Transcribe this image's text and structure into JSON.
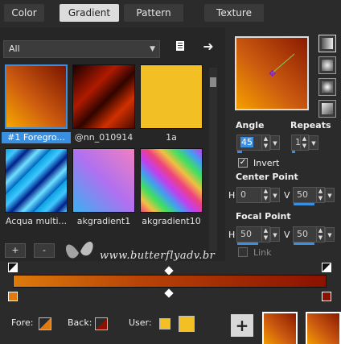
{
  "tabs": [
    {
      "label": "Color",
      "active": false
    },
    {
      "label": "Gradient",
      "active": true
    },
    {
      "label": "Pattern",
      "active": false
    },
    {
      "label": "Texture",
      "active": false
    }
  ],
  "library": {
    "filter_value": "All",
    "items": [
      {
        "label": "#1 Foregro...",
        "selected": true
      },
      {
        "label": "@nn_010914",
        "selected": false
      },
      {
        "label": "1a",
        "selected": false
      },
      {
        "label": "Acqua multi...",
        "selected": false
      },
      {
        "label": "akgradient1",
        "selected": false
      },
      {
        "label": "akgradient10",
        "selected": false
      }
    ],
    "add_label": "+",
    "remove_label": "-"
  },
  "watermark": "www.butterflyadv.br",
  "properties": {
    "angle_label": "Angle",
    "angle_value": "45",
    "repeats_label": "Repeats",
    "repeats_value": "1",
    "invert_label": "Invert",
    "invert_checked": true,
    "center_label": "Center Point",
    "center_h_label": "H",
    "center_h_value": "0",
    "center_v_label": "V",
    "center_v_value": "50",
    "focal_label": "Focal Point",
    "focal_h_label": "H",
    "focal_h_value": "50",
    "focal_v_label": "V",
    "focal_v_value": "50",
    "link_label": "Link"
  },
  "bottom": {
    "fore_label": "Fore:",
    "back_label": "Back:",
    "user_label": "User:",
    "add_label": "+"
  },
  "colors": {
    "accent": "#3a8fe0",
    "fore": "#e07a10",
    "back": "#8b1200",
    "user": "#f2c024"
  }
}
